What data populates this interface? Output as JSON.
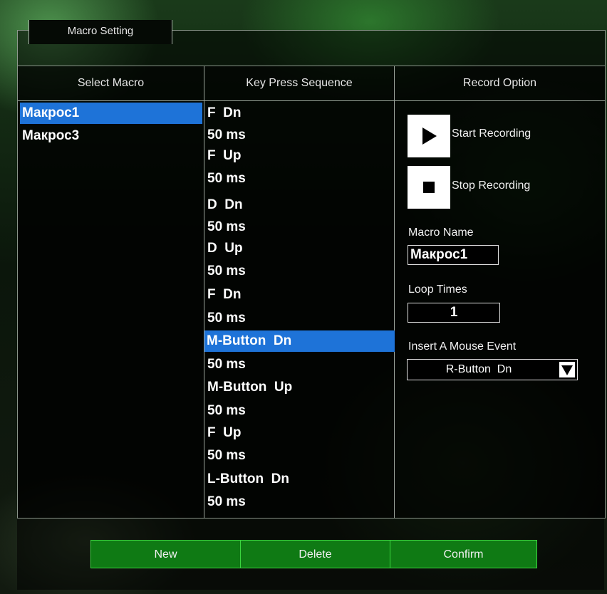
{
  "group": {
    "title": "Macro Setting"
  },
  "columns": {
    "select_macro": "Select Macro",
    "key_sequence": "Key Press Sequence",
    "record_option": "Record Option"
  },
  "macros": [
    {
      "label": "Макрос1",
      "selected": true
    },
    {
      "label": "Макрос3",
      "selected": false
    }
  ],
  "sequence": [
    {
      "label": "F  Dn"
    },
    {
      "label": "50 ms"
    },
    {
      "label": "F  Up"
    },
    {
      "label": "50 ms"
    },
    {
      "label": "D  Dn"
    },
    {
      "label": "50 ms"
    },
    {
      "label": "D  Up"
    },
    {
      "label": "50 ms"
    },
    {
      "label": "F  Dn"
    },
    {
      "label": "50 ms"
    },
    {
      "label": "M-Button  Dn",
      "selected": true
    },
    {
      "label": "50 ms"
    },
    {
      "label": "M-Button  Up"
    },
    {
      "label": "50 ms"
    },
    {
      "label": "F  Up"
    },
    {
      "label": "50 ms"
    },
    {
      "label": "L-Button  Dn"
    },
    {
      "label": "50 ms"
    }
  ],
  "record": {
    "start_label": "Start Recording",
    "stop_label": "Stop Recording",
    "start_icon": "play-icon",
    "stop_icon": "stop-icon"
  },
  "fields": {
    "macro_name_label": "Macro Name",
    "macro_name_value": "Макрос1",
    "loop_times_label": "Loop Times",
    "loop_times_value": "1",
    "mouse_event_label": "Insert A Mouse Event",
    "mouse_event_value": "R-Button  Dn",
    "dropdown_icon": "dropdown-arrow-icon"
  },
  "buttons": {
    "new": "New",
    "delete": "Delete",
    "confirm": "Confirm"
  },
  "colors": {
    "selection": "#1e73d8",
    "button_fill": "#0f7a14",
    "button_border": "#3bd63f"
  }
}
